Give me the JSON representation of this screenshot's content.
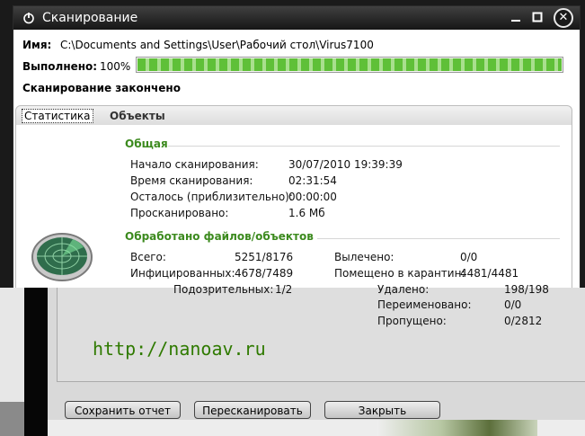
{
  "window": {
    "title": "Сканирование",
    "name_label": "Имя:",
    "name_value": "C:\\Documents and Settings\\User\\Рабочий стол\\Virus7100",
    "done_label": "Выполнено:",
    "done_value": "100%",
    "progress_percent": 100,
    "status": "Сканирование закончено"
  },
  "tabs": [
    {
      "label": "Статистика",
      "active": true
    },
    {
      "label": "Объекты",
      "active": false
    }
  ],
  "general": {
    "title": "Общая",
    "rows": [
      {
        "label": "Начало сканирования:",
        "value": "30/07/2010 19:39:39"
      },
      {
        "label": "Время сканирования:",
        "value": "02:31:54"
      },
      {
        "label": "Осталось (приблизительно):",
        "value": "00:00:00"
      },
      {
        "label": "Просканировано:",
        "value": "1.6 Мб"
      }
    ]
  },
  "processed": {
    "title": "Обработано файлов/объектов",
    "rows": [
      {
        "label": "Всего:",
        "value": "5251/8176"
      },
      {
        "label": "Инфицированных:",
        "value": "4678/7489"
      },
      {
        "label": "Вылечено:",
        "value": "0/0"
      },
      {
        "label": "Помещено в карантин:",
        "value": "4481/4481"
      }
    ],
    "lower_rows": [
      {
        "label": "Подозрительных:",
        "value": "1/2"
      },
      {
        "label": "Удалено:",
        "value": "198/198"
      },
      {
        "label": "Переименовано:",
        "value": "0/0"
      },
      {
        "label": "Пропущено:",
        "value": "0/2812"
      }
    ]
  },
  "watermark": "http://nanoav.ru",
  "buttons": {
    "save": "Сохранить отчет",
    "rescan": "Пересканировать",
    "close": "Закрыть"
  },
  "colors": {
    "section": "#3c8a1e",
    "url": "#2f7a00",
    "progress": "#5fc038"
  }
}
